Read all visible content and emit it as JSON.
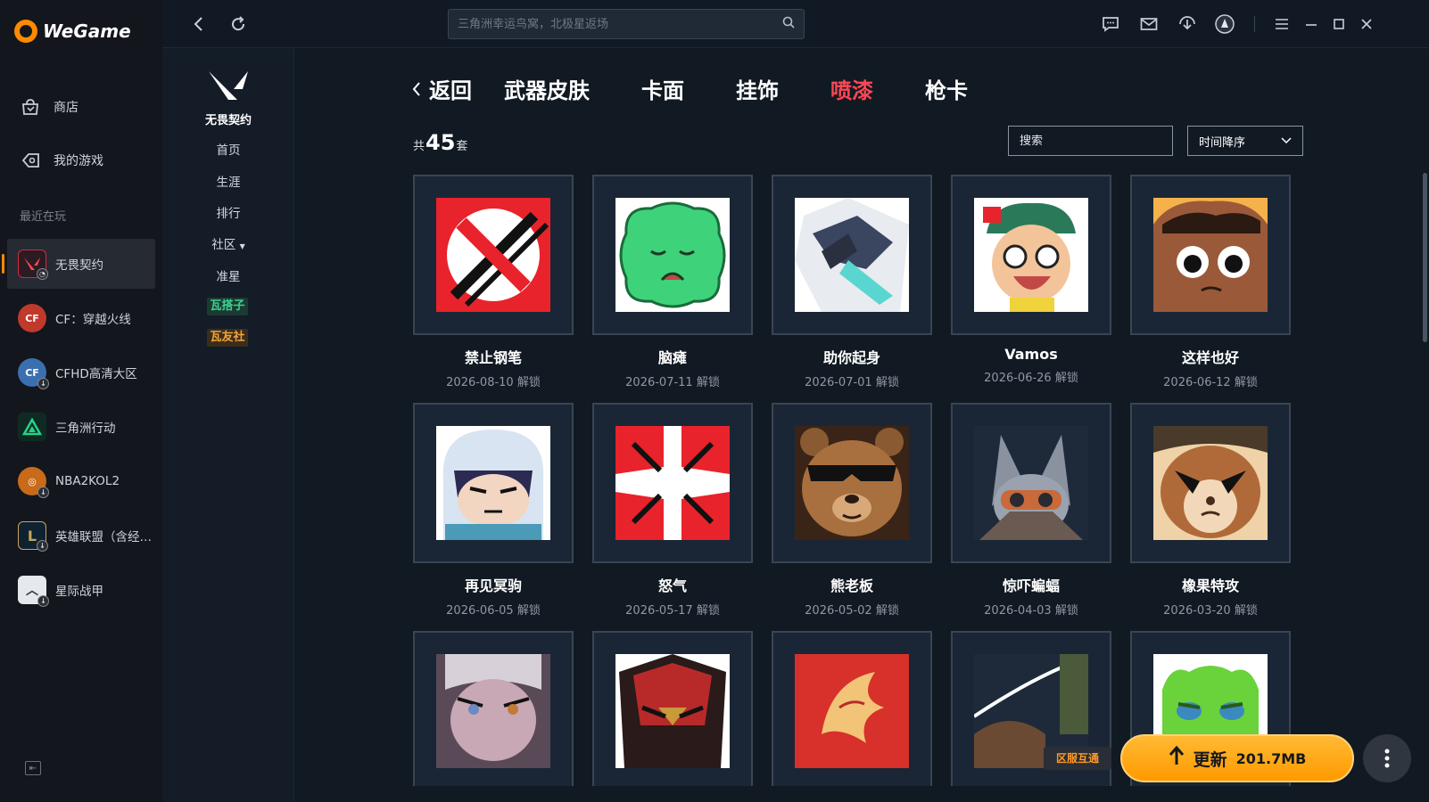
{
  "app": {
    "name": "WeGame"
  },
  "sidebar": {
    "nav": [
      {
        "label": "商店",
        "icon": "store-icon"
      },
      {
        "label": "我的游戏",
        "icon": "games-icon"
      }
    ],
    "recent_label": "最近在玩",
    "games": [
      {
        "label": "无畏契约",
        "icon": "valorant-icon",
        "color": "#d6283c",
        "active": true
      },
      {
        "label": "CF：穿越火线",
        "icon": "cf-icon",
        "color": "#c1392b"
      },
      {
        "label": "CFHD高清大区",
        "icon": "cfhd-icon",
        "color": "#3a6fb0"
      },
      {
        "label": "三角洲行动",
        "icon": "delta-icon",
        "color": "#1a8a5e"
      },
      {
        "label": "NBA2KOL2",
        "icon": "nba-icon",
        "color": "#c86a1a"
      },
      {
        "label": "英雄联盟（含经…",
        "icon": "lol-icon",
        "color": "#1f6fa0"
      },
      {
        "label": "星际战甲",
        "icon": "warframe-icon",
        "color": "#e5e8ec"
      }
    ]
  },
  "topbar": {
    "search_placeholder": "三角洲幸运鸟窝，北极星返场"
  },
  "subnav": {
    "game_name": "无畏契约",
    "items": [
      "首页",
      "生涯",
      "排行",
      "社区",
      "准星"
    ],
    "tags": [
      {
        "label": "瓦搭子",
        "color": "#3ecf8e"
      },
      {
        "label": "瓦友社",
        "color": "#f2a33a"
      }
    ]
  },
  "main": {
    "back_label": "返回",
    "tabs": [
      "武器皮肤",
      "卡面",
      "挂饰",
      "喷漆",
      "枪卡"
    ],
    "active_tab": "喷漆",
    "count_prefix": "共",
    "count": "45",
    "count_suffix": "套",
    "filter_search_placeholder": "搜索",
    "sort_label": "时间降序",
    "unlock_suffix": "解锁",
    "cards": [
      {
        "name": "禁止钢笔",
        "date": "2026-08-10 解锁"
      },
      {
        "name": "脑瘫",
        "date": "2026-07-11 解锁"
      },
      {
        "name": "助你起身",
        "date": "2026-07-01 解锁"
      },
      {
        "name": "Vamos",
        "date": "2026-06-26 解锁"
      },
      {
        "name": "这样也好",
        "date": "2026-06-12 解锁"
      },
      {
        "name": "再见冥驹",
        "date": "2026-06-05 解锁"
      },
      {
        "name": "怒气",
        "date": "2026-05-17 解锁"
      },
      {
        "name": "熊老板",
        "date": "2026-05-02 解锁"
      },
      {
        "name": "惊吓蝙蝠",
        "date": "2026-04-03 解锁"
      },
      {
        "name": "橡果特攻",
        "date": "2026-03-20 解锁"
      },
      {
        "name": "",
        "date": ""
      },
      {
        "name": "",
        "date": ""
      },
      {
        "name": "",
        "date": ""
      },
      {
        "name": "",
        "date": ""
      },
      {
        "name": "",
        "date": ""
      }
    ]
  },
  "bottom": {
    "region_label": "区服互通",
    "update_label": "更新",
    "update_size": "201.7MB",
    "more_icon": "more-vertical-icon"
  }
}
